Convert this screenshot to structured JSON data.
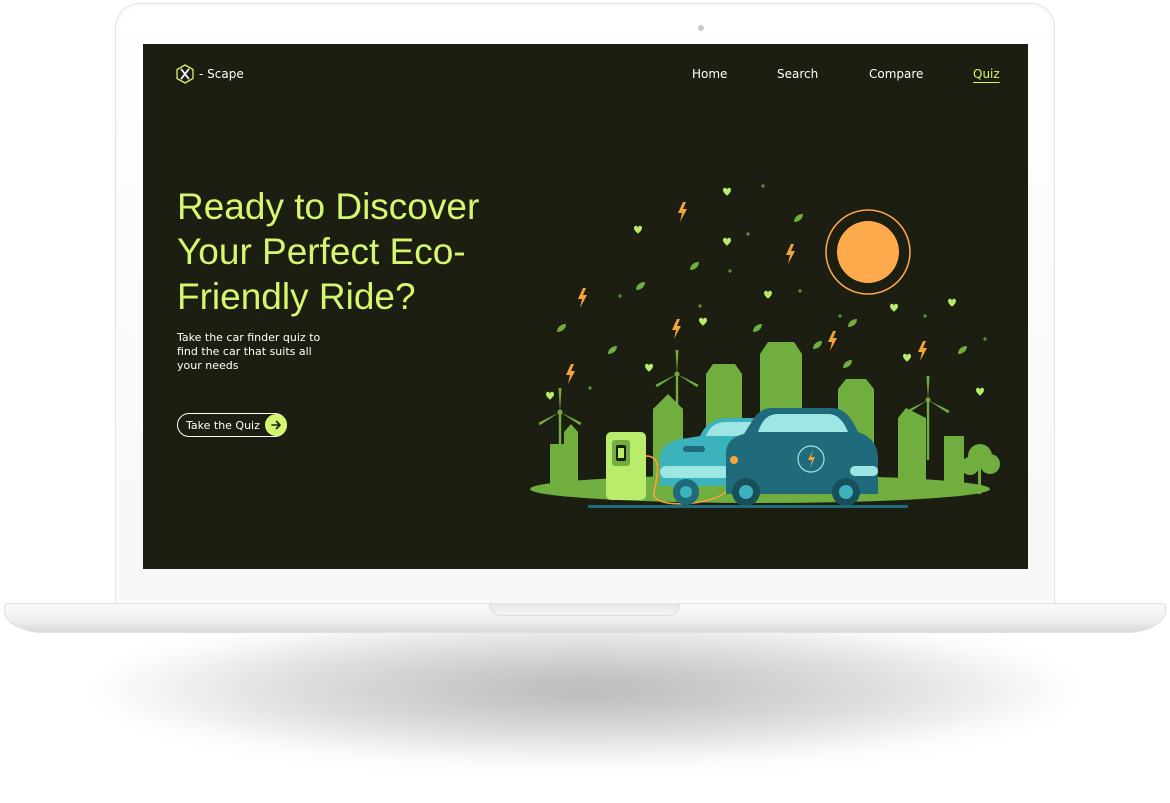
{
  "brand": {
    "name": "- Scape",
    "logo_icon": "x-hexagon-logo-icon"
  },
  "nav": {
    "items": [
      {
        "label": "Home"
      },
      {
        "label": "Search"
      },
      {
        "label": "Compare"
      },
      {
        "label": "Quiz",
        "active": true
      }
    ]
  },
  "hero": {
    "headline": "Ready to Discover Your Perfect Eco-Friendly Ride?",
    "subtext": "Take the car finder quiz to find the car that suits all your needs",
    "cta_label": "Take the Quiz",
    "cta_icon": "arrow-right-icon"
  },
  "colors": {
    "background": "#1b1e10",
    "accent": "#d4f76f",
    "text": "#ffffff",
    "sun": "#ffaa4d",
    "lightning": "#f6a33c",
    "greenery": "#6fae3f",
    "car_front": "#3cb3bc",
    "car_back": "#1f6b7c"
  }
}
